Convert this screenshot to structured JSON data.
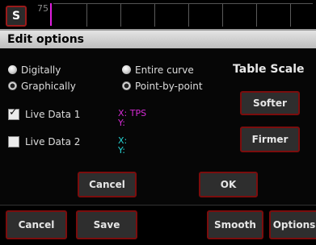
{
  "topbar": {
    "badge": "S",
    "value": "75"
  },
  "dialog": {
    "title": "Edit options",
    "mode_options": [
      {
        "label": "Digitally",
        "selected": false
      },
      {
        "label": "Graphically",
        "selected": true
      }
    ],
    "scope_options": [
      {
        "label": "Entire curve",
        "selected": false
      },
      {
        "label": "Point-by-point",
        "selected": true
      }
    ],
    "table_scale": {
      "title": "Table Scale",
      "softer": "Softer",
      "firmer": "Firmer"
    },
    "live_data": [
      {
        "label": "Live Data 1",
        "checked": true,
        "x": "X: TPS",
        "y": "Y:",
        "color": "#d42bd4"
      },
      {
        "label": "Live Data 2",
        "checked": false,
        "x": "X:",
        "y": "Y:",
        "color": "#26d3d3"
      }
    ],
    "cancel": "Cancel",
    "ok": "OK"
  },
  "bottom_bar": {
    "cancel": "Cancel",
    "save": "Save",
    "smooth": "Smooth",
    "options": "Options"
  },
  "colors": {
    "accent_border": "#7b0d0d",
    "marker": "#e01ee0"
  }
}
